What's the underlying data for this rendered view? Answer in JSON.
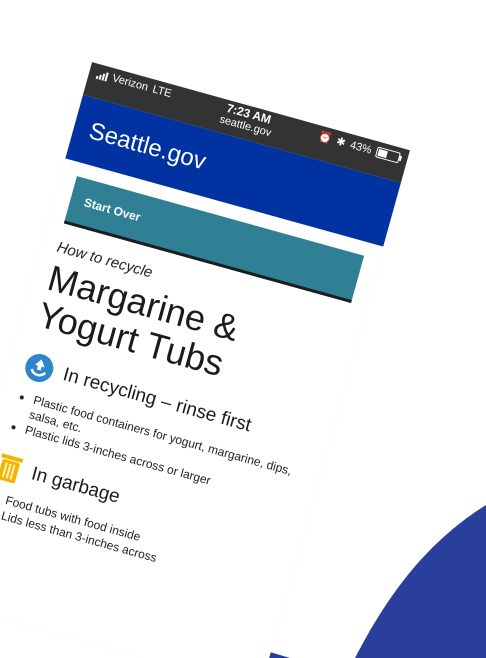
{
  "status_bar": {
    "carrier": "Verizon",
    "network": "LTE",
    "time": "7:23 AM",
    "url": "seattle.gov",
    "battery_percent": "43%",
    "battery_level": 0.43
  },
  "header": {
    "site_title": "Seattle.gov"
  },
  "content": {
    "start_over_label": "Start Over",
    "eyebrow": "How to recycle",
    "title": "Margarine & Yogurt Tubs",
    "recycling": {
      "heading": "In recycling – rinse first",
      "items": [
        "Plastic food containers for yogurt, margarine, dips, salsa, etc.",
        "Plastic lids 3-inches across or larger"
      ]
    },
    "garbage": {
      "heading": "In garbage",
      "items": [
        "Food tubs with food inside",
        "Lids less than 3-inches across"
      ]
    }
  },
  "colors": {
    "header_blue": "#0033a1",
    "start_over_teal": "#2f7f95",
    "background_navy": "#2a3f9c",
    "recycle_blue": "#2e86c9",
    "garbage_gold": "#f5b400"
  }
}
